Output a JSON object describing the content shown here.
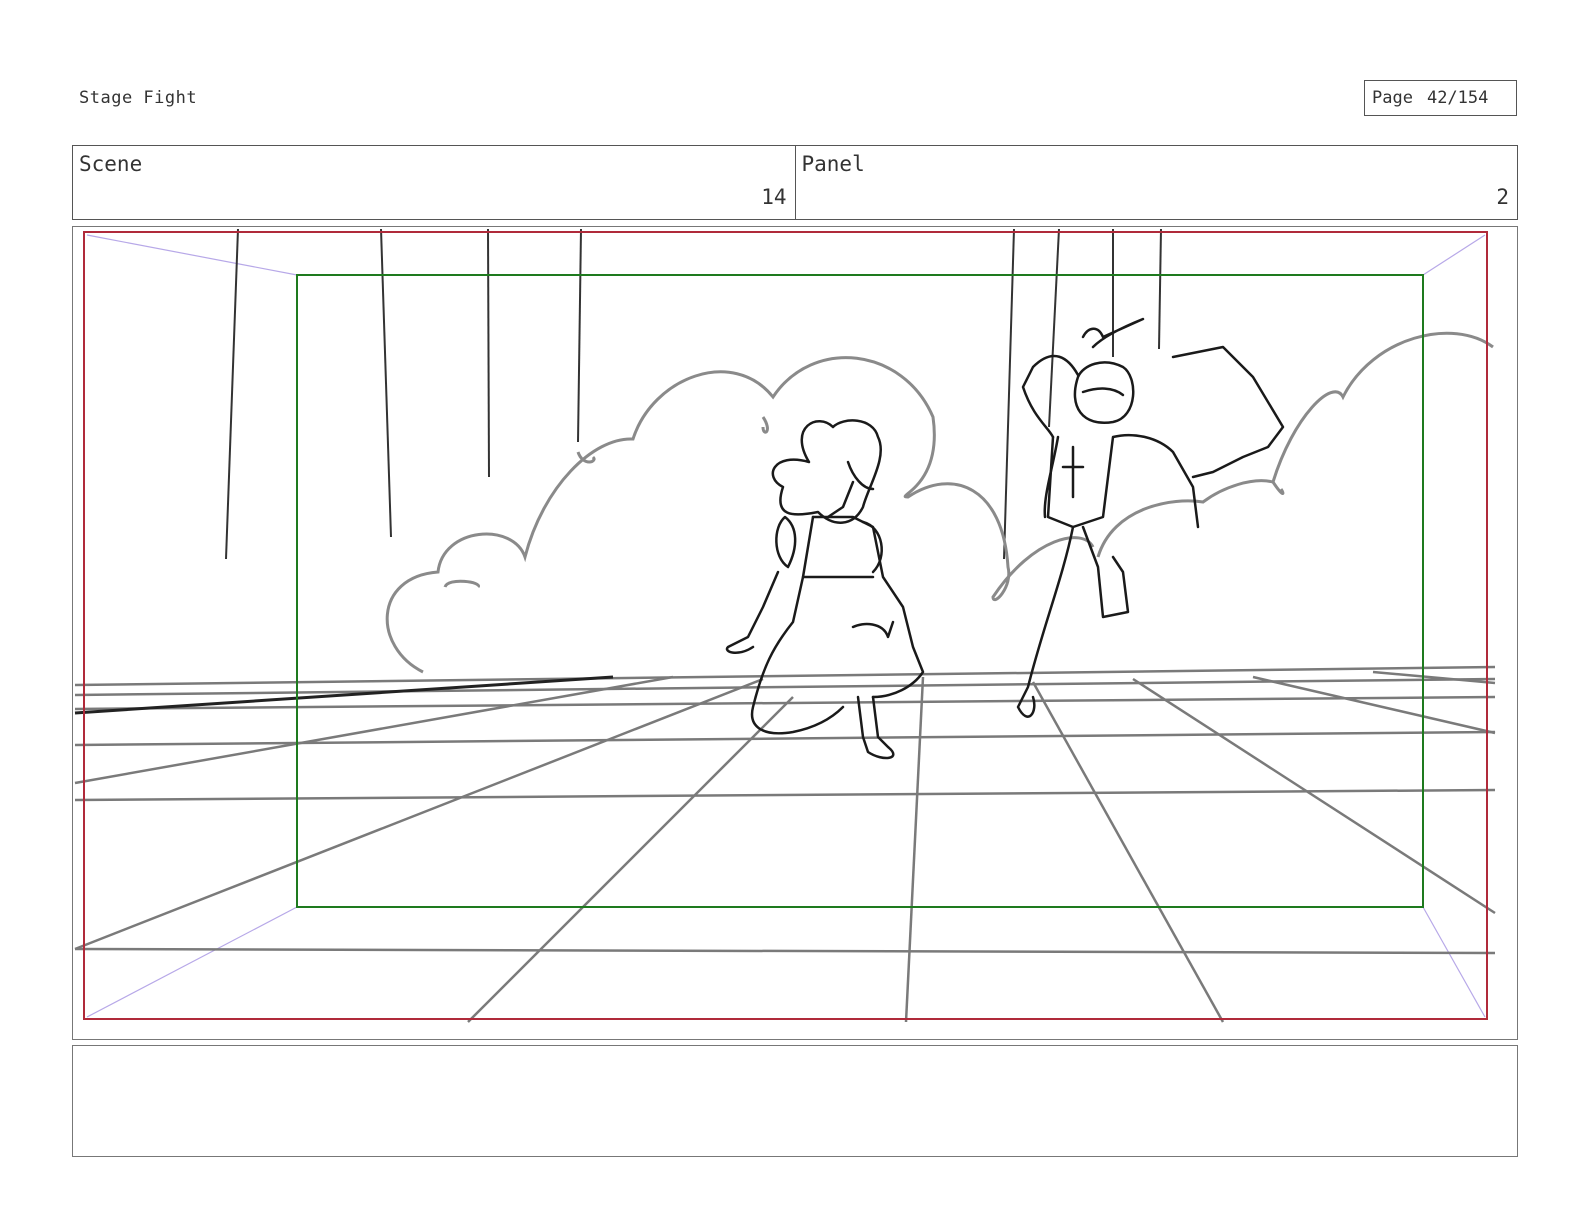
{
  "document": {
    "title": "Stage Fight"
  },
  "page": {
    "label": "Page",
    "number": "42/154"
  },
  "scene": {
    "label": "Scene",
    "value": "14"
  },
  "panel": {
    "label": "Panel",
    "value": "2"
  },
  "notes": {
    "text": ""
  },
  "colors": {
    "safe_area": "#1e7a1e",
    "frame_edge": "#b02a3a",
    "guides": "#b7a8e8",
    "sketch": "#222222",
    "scenery": "#8a8a8a"
  }
}
